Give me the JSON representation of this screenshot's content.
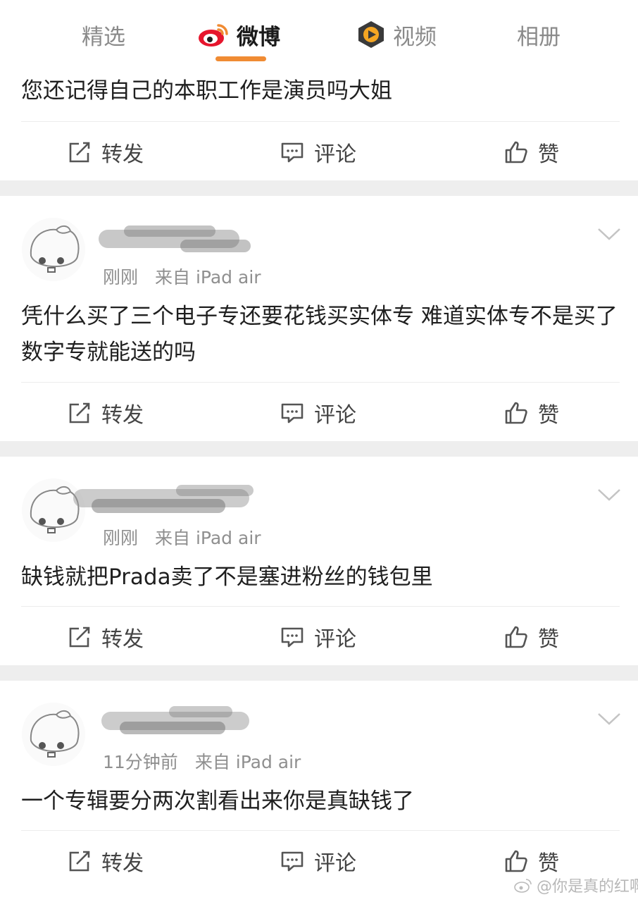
{
  "tabs": [
    {
      "label": "精选"
    },
    {
      "label": "微博"
    },
    {
      "label": "视频"
    },
    {
      "label": "相册"
    }
  ],
  "actions": {
    "repost": "转发",
    "comment": "评论",
    "like": "赞"
  },
  "posts": [
    {
      "text": "您还记得自己的本职工作是演员吗大姐"
    },
    {
      "time": "刚刚",
      "source": "来自 iPad air",
      "text": "凭什么买了三个电子专还要花钱买实体专 难道实体专不是买了数字专就能送的吗"
    },
    {
      "time": "刚刚",
      "source": "来自 iPad air",
      "text": "缺钱就把Prada卖了不是塞进粉丝的钱包里"
    },
    {
      "time": "11分钟前",
      "source": "来自 iPad air",
      "text": "一个专辑要分两次割看出来你是真缺钱了"
    }
  ],
  "watermark": "@你是真的红啊",
  "colors": {
    "accent": "#f08b33",
    "separator": "#eeeeee"
  }
}
